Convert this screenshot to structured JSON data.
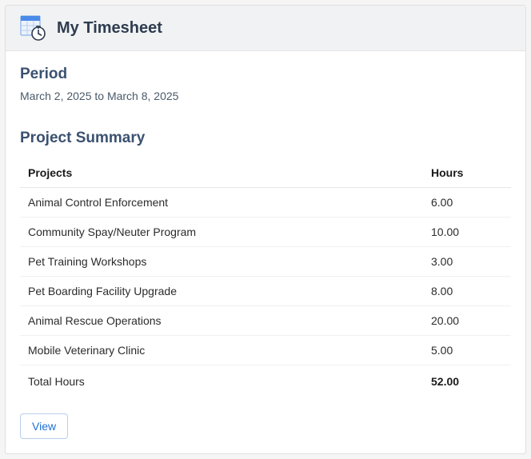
{
  "header": {
    "title": "My Timesheet"
  },
  "period": {
    "label": "Period",
    "range": "March 2, 2025 to March 8, 2025"
  },
  "summary": {
    "title": "Project Summary",
    "columns": {
      "projects": "Projects",
      "hours": "Hours"
    },
    "rows": [
      {
        "project": "Animal Control Enforcement",
        "hours": "6.00"
      },
      {
        "project": "Community Spay/Neuter Program",
        "hours": "10.00"
      },
      {
        "project": "Pet Training Workshops",
        "hours": "3.00"
      },
      {
        "project": "Pet Boarding Facility Upgrade",
        "hours": "8.00"
      },
      {
        "project": "Animal Rescue Operations",
        "hours": "20.00"
      },
      {
        "project": "Mobile Veterinary Clinic",
        "hours": "5.00"
      }
    ],
    "total": {
      "label": "Total Hours",
      "hours": "52.00"
    }
  },
  "actions": {
    "view": "View"
  },
  "colors": {
    "accent": "#1f6fd6",
    "icon_primary": "#4a8ae8",
    "heading": "#3b5170"
  }
}
